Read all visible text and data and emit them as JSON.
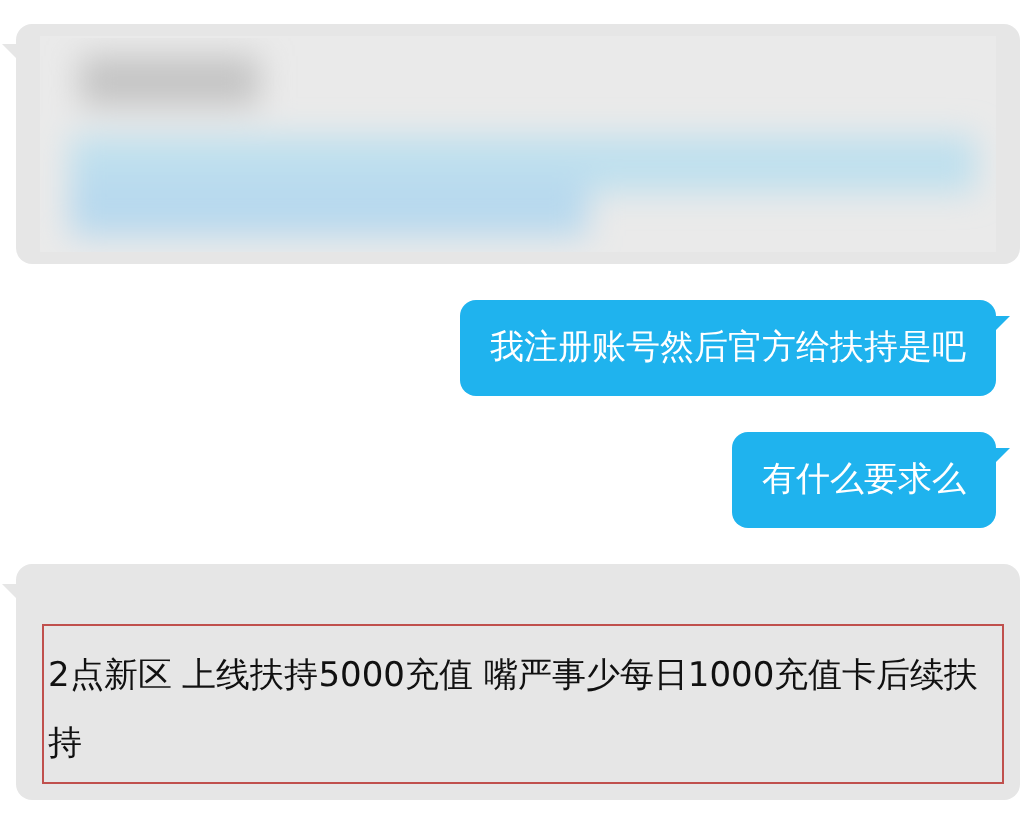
{
  "messages": [
    {
      "kind": "blurred"
    },
    {
      "kind": "outgoing",
      "text": "我注册账号然后官方给扶持是吧"
    },
    {
      "kind": "outgoing",
      "text": "有什么要求么"
    },
    {
      "kind": "boxed",
      "text": "2点新区 上线扶持5000充值 嘴严事少每日1000充值卡后续扶持"
    }
  ]
}
